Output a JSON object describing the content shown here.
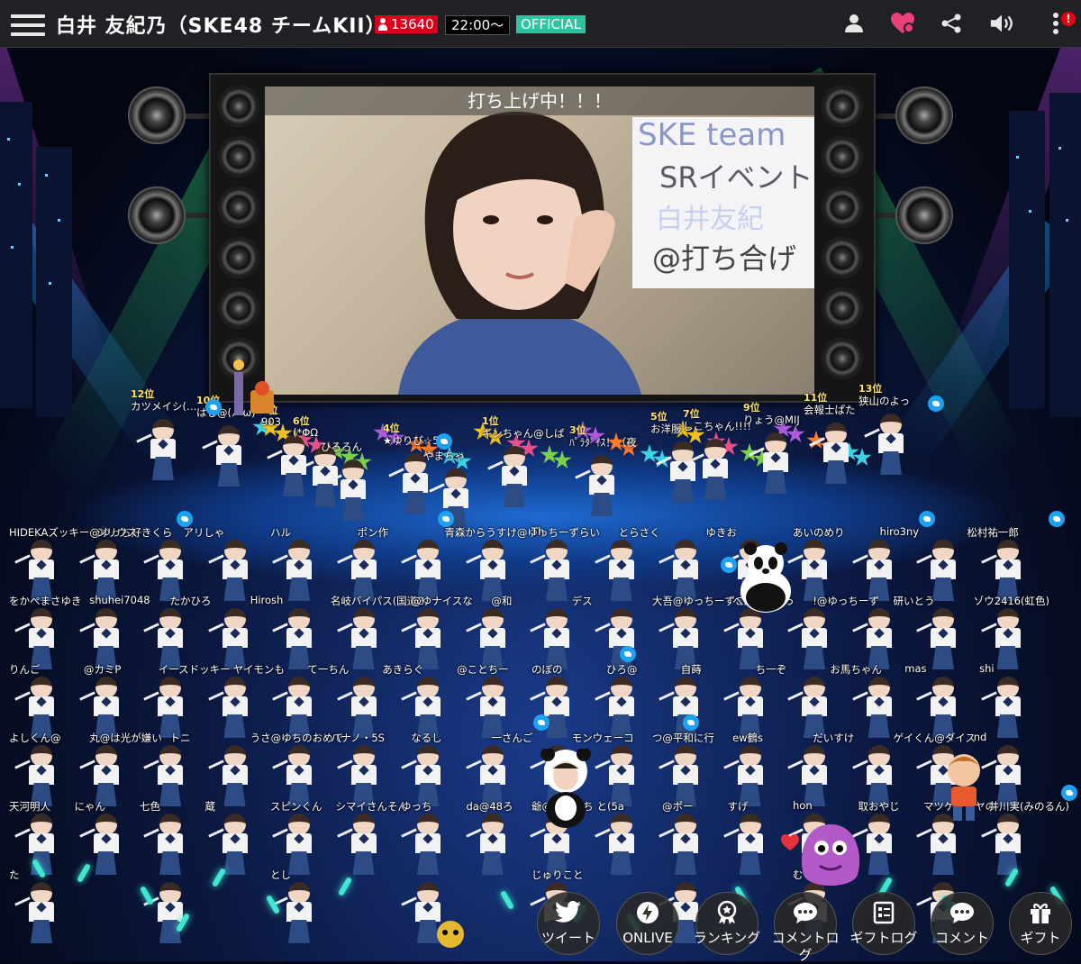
{
  "header": {
    "title": "白井 友紀乃（SKE48 チームKII）",
    "viewer_count": "13640",
    "time": "22:00〜",
    "official": "OFFICIAL",
    "notification_count": "!"
  },
  "video": {
    "caption": "打ち上げ中！！！",
    "whiteboard_lines": [
      "SKE team",
      "SRイベント",
      "白井友紀",
      "@打ち合げ"
    ]
  },
  "ranks": [
    {
      "rank": "12位",
      "name": "カツメイシ(…"
    },
    {
      "rank": "10位",
      "name": "はし@(ﾉ•ω)"
    },
    {
      "rank": "8位",
      "name": "903"
    },
    {
      "rank": "6位",
      "name": "(*ΦΩ"
    },
    {
      "rank": "",
      "name": "ひろろん"
    },
    {
      "rank": "4位",
      "name": "★ゆりぴ☆5"
    },
    {
      "rank": "",
      "name": "やまちゃ"
    },
    {
      "rank": "1位",
      "name": "キンちゃん@しば"
    },
    {
      "rank": "3位",
      "name": "ﾊﾟﾗﾀﾞｲｽ！（夜"
    },
    {
      "rank": "5位",
      "name": "お洋服"
    },
    {
      "rank": "7位",
      "name": "しこちゃん!!!!"
    },
    {
      "rank": "9位",
      "name": "りょう@MIJ"
    },
    {
      "rank": "11位",
      "name": "会報士ぱた"
    },
    {
      "rank": "13位",
      "name": "狭山のよっ"
    }
  ],
  "fans": {
    "row1": [
      "HIDEKAズッキー@ゆっち好きくら",
      "シリウス",
      "アリしゃ",
      "ハル",
      "ポン作",
      "青森からうすけ@ゆっちーずらい",
      "Th",
      "とらさく",
      "ゆきお",
      "あいのめり",
      "hiro3ny",
      "松村祐一郎"
    ],
    "row2": [
      "をかぺまさゆき",
      "shuhei7048",
      "たかひろ",
      "Hirosh",
      "名岐バイパス(国道2",
      "@ゆナイスな",
      "@和",
      "デス",
      "大吾@ゆっちーずごま太郎",
      "ヘン街道まっ",
      "!@ゆっちーず",
      "研いとう",
      "ゾウ2416(虹色)"
    ],
    "row3": [
      "りんご",
      "@カミP",
      "イースドッキー",
      "ヤイモンも",
      "て一ちん",
      "あきらぐ",
      "@ことちー",
      "のぼの",
      "ひろ@",
      "自蒔",
      "ち一ぞ",
      "お馬ちゃん",
      "mas",
      "shi"
    ],
    "row4": [
      "よしくん@",
      "丸@は光が嫌い",
      "トニ",
      "うさ@ゆちのおめで",
      "ハナノ・5S",
      "なるし",
      "一さんご",
      "モンウェーコ",
      "つ@平和に行",
      "ew鶴s",
      "だいすけ",
      "ゲイくん@ダイス",
      "nd"
    ],
    "row5": [
      "天河明人",
      "にゃん",
      "七色",
      "蔵",
      "スピンくん",
      "シマイさんそん",
      "ゆっち",
      "da@48ろ",
      "爺@ことっち",
      "と(5a",
      "@ポー",
      "すげ",
      "hon",
      "取おやじ",
      "マツケンゴヤの",
      "井川実(みのるん)"
    ],
    "row6": [
      "た",
      "とし",
      "じゅりこと",
      "むくす"
    ]
  },
  "buttons": [
    {
      "label": "ツイート",
      "icon": "twitter-icon"
    },
    {
      "label": "ONLIVE",
      "icon": "lightning-icon"
    },
    {
      "label": "ランキング",
      "icon": "ranking-medal-icon"
    },
    {
      "label": "コメントログ",
      "icon": "comment-log-icon"
    },
    {
      "label": "ギフトログ",
      "icon": "gift-log-icon"
    },
    {
      "label": "コメント",
      "icon": "comment-icon"
    },
    {
      "label": "ギフト",
      "icon": "gift-icon"
    }
  ],
  "colors": {
    "topbar": "#202124",
    "viewer_badge": "#d8001a",
    "official_badge": "#2ec4a0",
    "heart": "#e8407a",
    "twitter": "#1da1f2",
    "rank_text": "#ffe36b"
  }
}
